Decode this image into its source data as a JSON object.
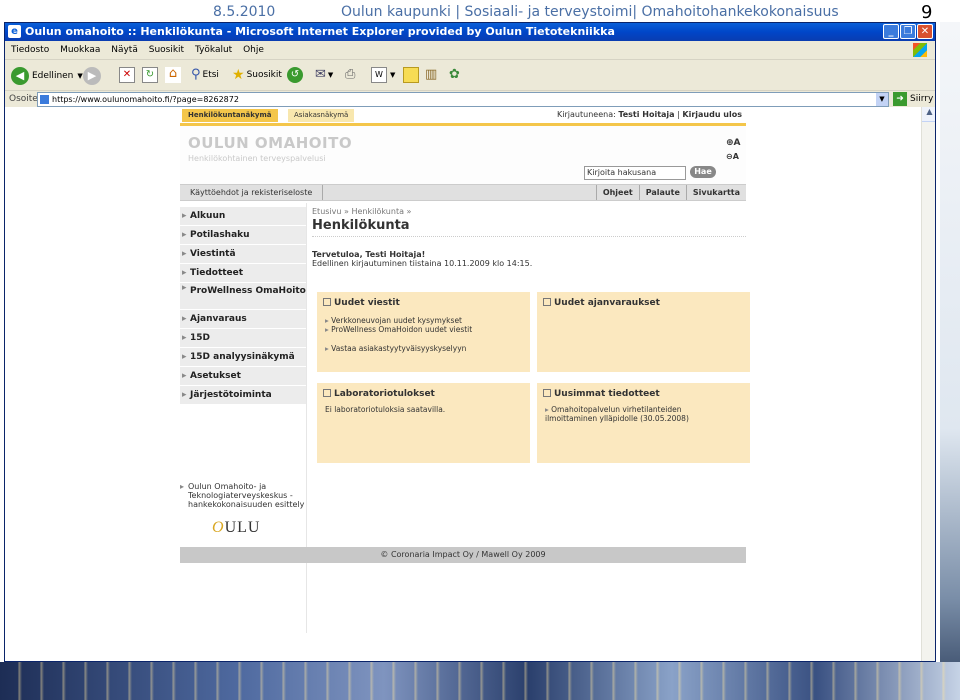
{
  "slide": {
    "date": "8.5.2010",
    "title": "Oulun kaupunki  |  Sosiaali- ja terveystoimi|  Omahoitohankekokonaisuus",
    "page_number": "9"
  },
  "window": {
    "title": "Oulun omahoito :: Henkilökunta - Microsoft Internet Explorer provided by Oulun Tietotekniikka",
    "buttons": [
      "_",
      "❐",
      "✕"
    ]
  },
  "menubar": [
    "Tiedosto",
    "Muokkaa",
    "Näytä",
    "Suosikit",
    "Työkalut",
    "Ohje"
  ],
  "toolbar": {
    "back": "Edellinen",
    "search": "Etsi",
    "favorites": "Suosikit"
  },
  "address": {
    "label": "Osoite",
    "url": "https://www.oulunomahoito.fi/?page=8262872",
    "go": "Siirry"
  },
  "site": {
    "tabs": [
      "Henkilökuntanäkymä",
      "Asiakasnäkymä"
    ],
    "login_prefix": "Kirjautuneena:",
    "login_user": "Testi Hoitaja",
    "logout": "Kirjaudu ulos",
    "brand_title": "OULUN OMAHOITO",
    "brand_subtitle": "Henkilökohtainen terveyspalvelusi",
    "search_placeholder": "Kirjoita hakusana",
    "search_button": "Hae",
    "font_plus": "+A",
    "font_minus": "-A",
    "terms_link": "Käyttöehdot ja rekisteriseloste",
    "help_links": [
      "Ohjeet",
      "Palaute",
      "Sivukartta"
    ],
    "nav": [
      "Alkuun",
      "Potilashaku",
      "Viestintä",
      "Tiedotteet",
      "ProWellness OmaHoito",
      "Ajanvaraus",
      "15D",
      "15D analyysinäkymä",
      "Asetukset",
      "Järjestötoiminta"
    ],
    "ext_link": "Oulun Omahoito- ja Teknologiaterveyskeskus -hankekokonaisuuden esittely",
    "oulu_logo": "OULU",
    "breadcrumb": "Etusivu » Henkilökunta »",
    "heading": "Henkilökunta",
    "welcome": "Tervetuloa, Testi Hoitaja!",
    "last_login": "Edellinen kirjautuminen tiistaina 10.11.2009 klo 14:15.",
    "boxes": {
      "messages": {
        "title": "Uudet viestit",
        "links": [
          "Verkkoneuvojan uudet kysymykset",
          "ProWellness OmaHoidon uudet viestit",
          "Vastaa asiakastyytyväisyyskyselyyn"
        ]
      },
      "appointments": {
        "title": "Uudet ajanvaraukset"
      },
      "labs": {
        "title": "Laboratoriotulokset",
        "text": "Ei laboratoriotuloksia saatavilla."
      },
      "news": {
        "title": "Uusimmat tiedotteet",
        "lines": [
          "Omahoitopalvelun virhetilanteiden",
          "ilmoittaminen ylläpidolle (30.05.2008)"
        ]
      }
    },
    "footer": "© Coronaria Impact Oy / Mawell Oy 2009"
  }
}
